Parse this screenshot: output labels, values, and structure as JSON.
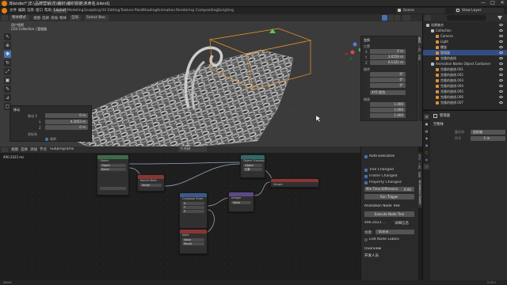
{
  "window": {
    "title": "Blender* [E:\\品牌营销\\花\\编织\\编织铁链\\未命名.blend]",
    "controls": [
      "—",
      "□",
      "✕"
    ]
  },
  "menubar": {
    "menus": [
      "文件",
      "编辑",
      "渲染",
      "窗口",
      "帮助"
    ],
    "workspaces": [
      "Layout",
      "Modeling",
      "Sculpting",
      "UV Editing",
      "Texture Paint",
      "Shading",
      "Animation",
      "Rendering",
      "Compositing",
      "Scripting"
    ],
    "active_workspace": "Layout",
    "scene": "Scene",
    "view_layer": "View Layer"
  },
  "viewport": {
    "header": {
      "mode": "物体模式",
      "menus": [
        "视图",
        "选择",
        "添加",
        "物体"
      ],
      "orientation": "全局",
      "drag": "Select Box"
    },
    "info": {
      "view": "用户透视",
      "collection": "(10) Collection | 管理器"
    },
    "n_panel": {
      "transform_title": "变换",
      "location_label": "位置",
      "location": [
        "0 m",
        "3.6559 m",
        "0.1322 m"
      ],
      "rotation_label": "旋转",
      "rotation": [
        "0°",
        "0°",
        "0°"
      ],
      "mode_label": "XYZ 欧拉",
      "scale_label": "缩放",
      "scale": [
        "1.000",
        "1.000",
        "1.000"
      ],
      "axes": [
        "X",
        "Y",
        "Z"
      ],
      "tabs": [
        "条目",
        "工具",
        "视图"
      ]
    },
    "redo_panel": {
      "title": "移动",
      "label": "移动 X",
      "rows": [
        {
          "axis": "X",
          "value": "0 m"
        },
        {
          "axis": "Y",
          "value": "4.3053 m"
        },
        {
          "axis": "Z",
          "value": "0 m"
        }
      ],
      "orient": "坐标系",
      "snap": "吸附"
    }
  },
  "node_editor": {
    "header_menus": [
      "视图",
      "选择",
      "添加",
      "节点"
    ],
    "tree_label": "Subprograms",
    "tree_name": "节点树",
    "timing": "490.2023 ms",
    "nodes": [
      {
        "title": "Object",
        "rows": [
          "Object",
          "Name"
        ]
      },
      {
        "title": "Vector Math",
        "rows": [
          "Vector"
        ]
      },
      {
        "title": "Object Transforms Output",
        "rows": [
          "Object",
          "位置",
          "旋转",
          "缩放"
        ]
      },
      {
        "title": "Compose Euler",
        "rows": [
          "X",
          "Y",
          "Z"
        ]
      },
      {
        "title": "Integer",
        "rows": [
          "Value"
        ]
      },
      {
        "title": "Math",
        "rows": [
          "Value"
        ]
      },
      {
        "title": "Float Math",
        "rows": [
          "Result"
        ]
      },
      {
        "title": "Viewer",
        "rows": [
          "Value"
        ]
      }
    ],
    "panel": {
      "auto_execution": "Auto Execution",
      "options": [
        "Tree Changed",
        "Frame Changed",
        "Property Changed"
      ],
      "min_time_label": "Min Time Difference",
      "min_time_value": "0.00",
      "trigger": "Run Trigger",
      "section2": "Animation Node Tree",
      "execute_button": "Execute Node Tree",
      "timing": "490.2023 ...",
      "more": "详细信息",
      "scene_label": "场景:",
      "scene": "Scene",
      "edit_labels": "Edit Node Labels",
      "overview": "Overview",
      "advanced": "开发人员",
      "tabs": [
        "节点",
        "工具",
        "视图",
        "Animation Nodes"
      ]
    }
  },
  "outliner": {
    "items": [
      {
        "label": "场景集合",
        "depth": 0,
        "icon": "#bbbbbb",
        "sel": false
      },
      {
        "label": "Collection",
        "depth": 1,
        "icon": "#bbbbbb",
        "sel": false
      },
      {
        "label": "Camera",
        "depth": 2,
        "icon": "#e0913a",
        "sel": false
      },
      {
        "label": "Light",
        "depth": 2,
        "icon": "#e0913a",
        "sel": false
      },
      {
        "label": "螺旋",
        "depth": 2,
        "icon": "#e0913a",
        "sel": false
      },
      {
        "label": "管理器",
        "depth": 2,
        "icon": "#e0913a",
        "sel": true
      },
      {
        "label": "克隆的曲线",
        "depth": 2,
        "icon": "#e0913a",
        "sel": false
      },
      {
        "label": "Animation Nodes Object Container",
        "depth": 1,
        "icon": "#bbbbbb",
        "sel": false
      },
      {
        "label": "克隆的曲线.001",
        "depth": 2,
        "icon": "#e0913a",
        "sel": false
      },
      {
        "label": "克隆的曲线.002",
        "depth": 2,
        "icon": "#e0913a",
        "sel": false
      },
      {
        "label": "克隆的曲线.003",
        "depth": 2,
        "icon": "#e0913a",
        "sel": false
      },
      {
        "label": "克隆的曲线.004",
        "depth": 2,
        "icon": "#e0913a",
        "sel": false
      },
      {
        "label": "克隆的曲线.005",
        "depth": 2,
        "icon": "#e0913a",
        "sel": false
      },
      {
        "label": "克隆的曲线.006",
        "depth": 2,
        "icon": "#e0913a",
        "sel": false
      },
      {
        "label": "克隆的曲线.007",
        "depth": 2,
        "icon": "#e0913a",
        "sel": false
      }
    ]
  },
  "properties": {
    "object_name": "管理器",
    "section": "空物体",
    "display_label": "显示为",
    "display_value": "坐标轴",
    "size_label": "尺寸",
    "size_value": "1 m"
  },
  "statusbar": {
    "text": "Select",
    "version": "2.93.1"
  },
  "colors": {
    "accent": "#4772b3",
    "selection_orange": "#f29727",
    "node_green": "#3d6b4a",
    "node_red": "#8a3434",
    "node_teal": "#2f6b67",
    "node_purple": "#5b4a87"
  }
}
